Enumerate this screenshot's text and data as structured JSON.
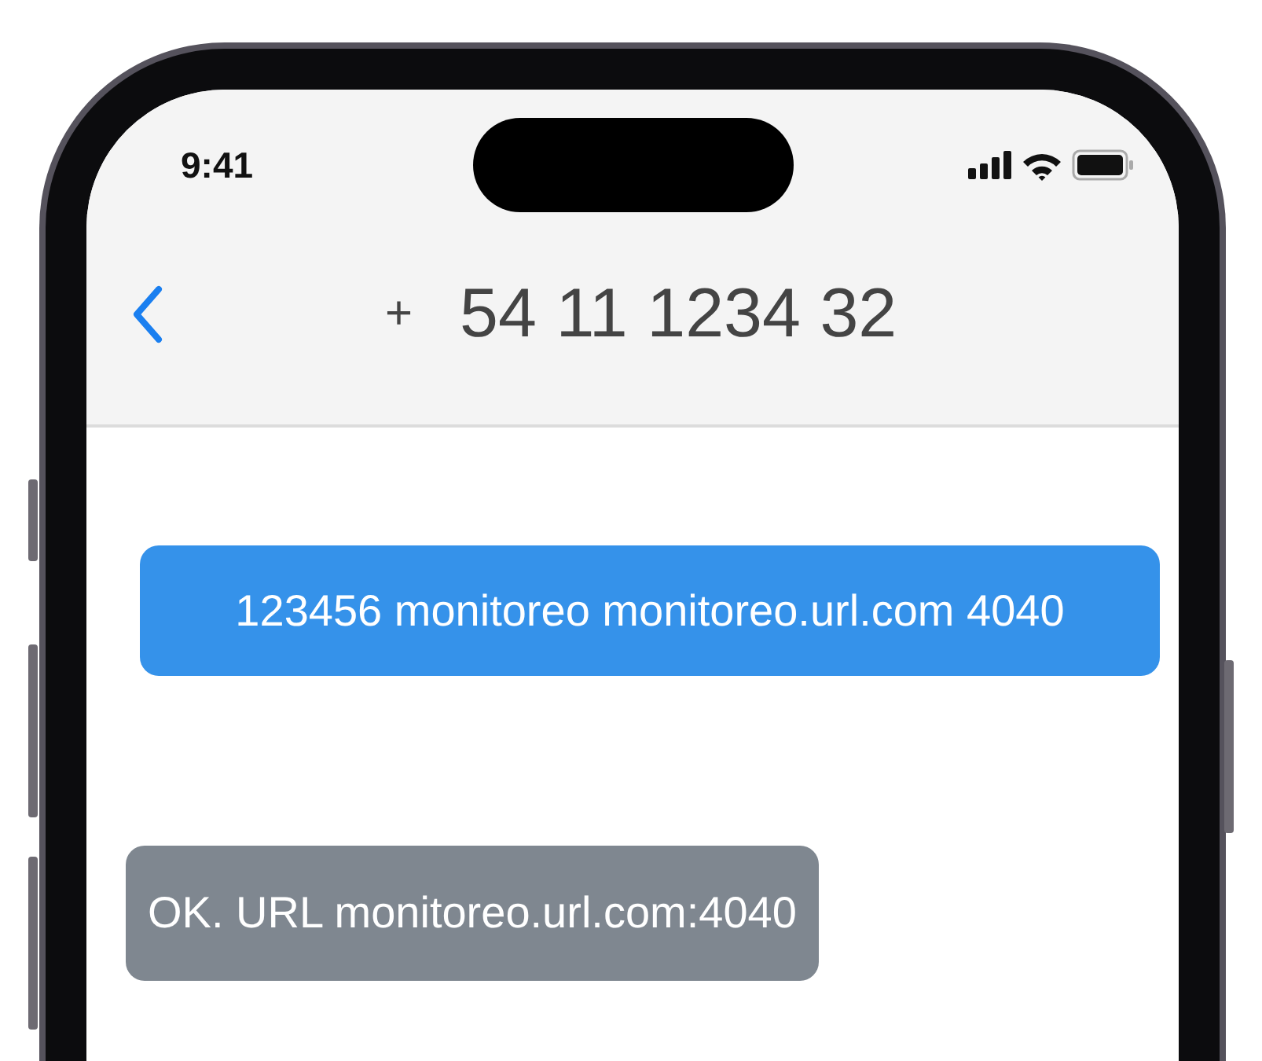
{
  "status_bar": {
    "time": "9:41"
  },
  "header": {
    "prefix": "+",
    "number": "54 11 1234 32"
  },
  "messages": [
    {
      "kind": "sent",
      "text": "123456 monitoreo monitoreo.url.com 4040"
    },
    {
      "kind": "received",
      "text": "OK. URL monitoreo.url.com:4040"
    }
  ]
}
